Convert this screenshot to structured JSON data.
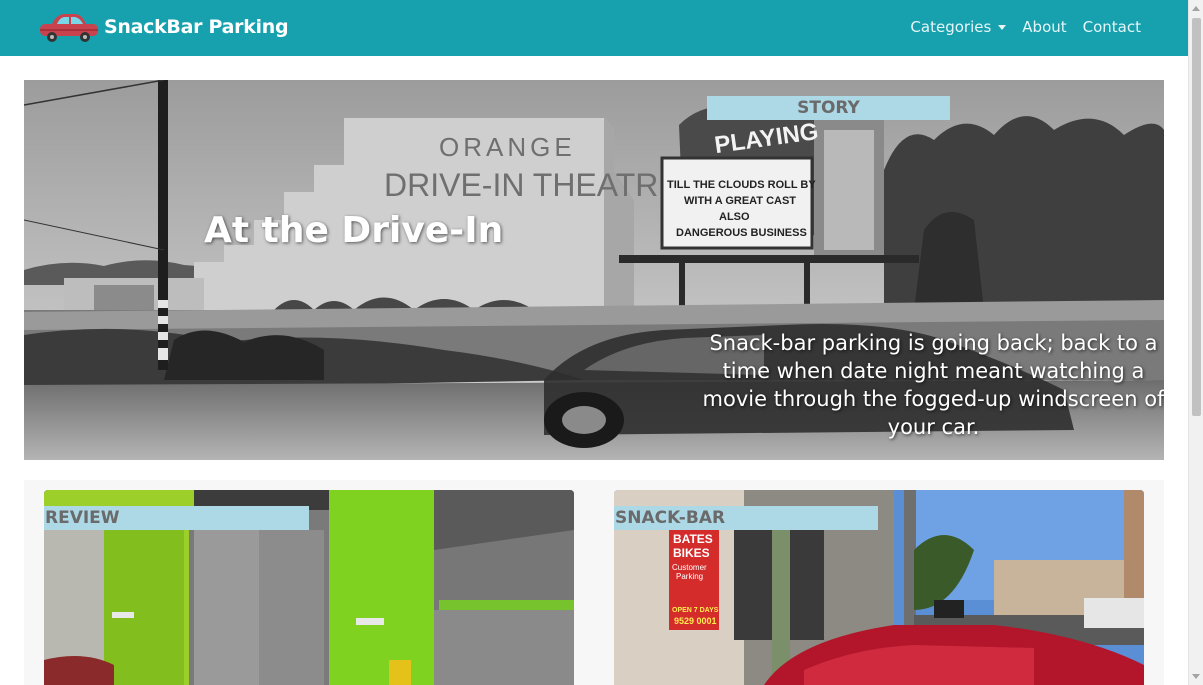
{
  "navbar": {
    "brand": "SnackBar Parking",
    "links": [
      {
        "label": "Categories",
        "dropdown": true
      },
      {
        "label": "About"
      },
      {
        "label": "Contact"
      }
    ],
    "colors": {
      "background": "#17a0ad",
      "link": "#e6f6f8"
    }
  },
  "hero": {
    "badge": "STORY",
    "title": "At the Drive-In",
    "description": "Snack-bar parking is going back; back to a time when date night meant watching a movie through the fogged-up windscreen of your car.",
    "image_signs": {
      "theatre_line1": "ORANGE",
      "theatre_line2": "DRIVE-IN THEATRE",
      "marquee_top": "PLAYING",
      "marquee_line1": "TILL THE CLOUDS ROLL BY",
      "marquee_line2": "WITH A GREAT CAST",
      "marquee_line3": "ALSO",
      "marquee_line4": "DANGEROUS BUSINESS"
    }
  },
  "cards": [
    {
      "badge": "REVIEW"
    },
    {
      "badge": "SNACK-BAR",
      "image_signs": {
        "shop_line1": "BATES",
        "shop_line2": "BIKES",
        "parking_line1": "Customer",
        "parking_line2": "Parking",
        "open_line": "OPEN 7 DAYS",
        "phone": "9529 0001"
      }
    }
  ],
  "badge_color": "#add8e6"
}
